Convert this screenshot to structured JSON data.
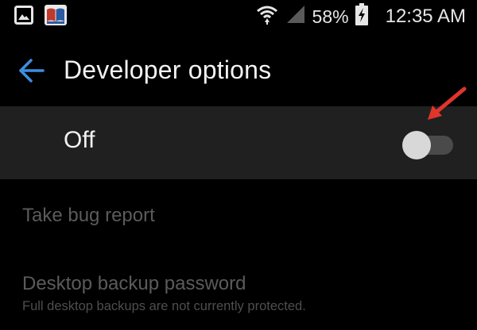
{
  "status_bar": {
    "battery": "58%",
    "time": "12:35 AM",
    "icons": [
      "gallery-icon",
      "book-app-icon",
      "wifi-icon",
      "signal-icon",
      "battery-charging-icon"
    ]
  },
  "header": {
    "title": "Developer options",
    "back_icon": "back-arrow-icon"
  },
  "master_switch": {
    "label": "Off",
    "state": "off"
  },
  "items": [
    {
      "title": "Take bug report",
      "summary": ""
    },
    {
      "title": "Desktop backup password",
      "summary": "Full desktop backups are not currently protected."
    }
  ],
  "colors": {
    "accent": "#3d8ee0",
    "background": "#000000",
    "bar": "#202020",
    "annotation": "#e0352b"
  }
}
